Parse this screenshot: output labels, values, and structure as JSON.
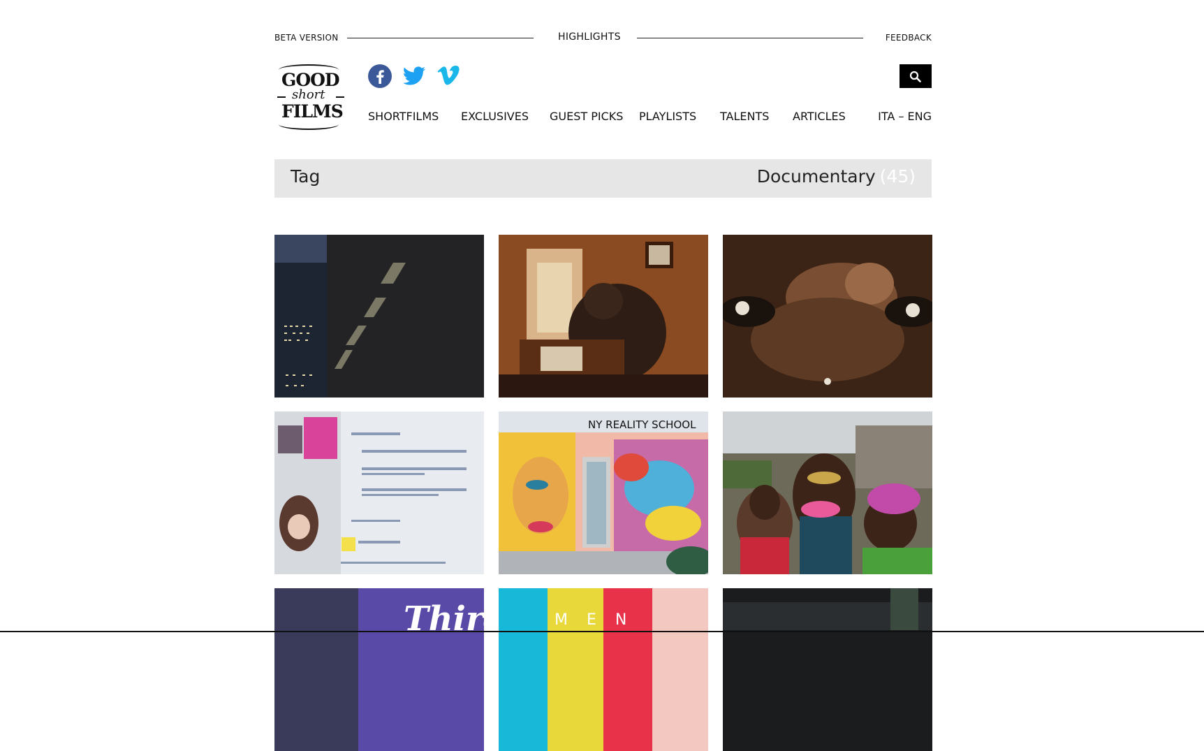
{
  "topbar": {
    "beta_label": "BETA VERSION",
    "highlights_label": "HIGHLIGHTS",
    "feedback_label": "FEEDBACK"
  },
  "logo": {
    "line1": "GOOD",
    "line2": "short",
    "line3": "FILMS"
  },
  "social": {
    "icons": [
      "facebook-icon",
      "twitter-icon",
      "vimeo-icon"
    ],
    "facebook_color": "#3b5998",
    "twitter_color": "#1da1f2",
    "vimeo_color": "#1ab7ea"
  },
  "nav": {
    "items": [
      "SHORTFILMS",
      "EXCLUSIVES",
      "GUEST PICKS",
      "PLAYLISTS",
      "TALENTS",
      "ARTICLES"
    ],
    "lang": "ITA – ENG"
  },
  "tag_bar": {
    "label": "Tag",
    "tag_name": "Documentary",
    "count": "(45)"
  },
  "thumbnails": {
    "row3_text_1": "Third",
    "row3_text_2": "M E N",
    "row2_text_1": "NY REALITY SCHOOL"
  }
}
